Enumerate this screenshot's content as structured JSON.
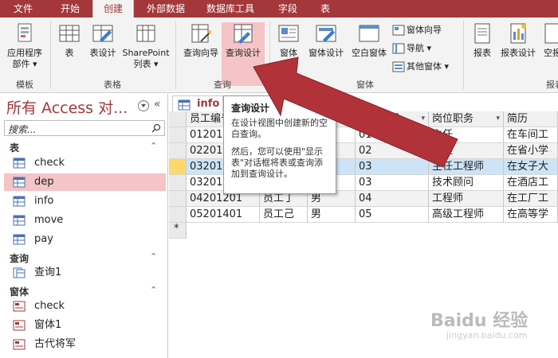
{
  "ribbon_tabs": [
    "文件",
    "开始",
    "创建",
    "外部数据",
    "数据库工具",
    "字段",
    "表"
  ],
  "ribbon": {
    "app_parts": "应用程序部件",
    "app_parts_line1": "应用程序",
    "app_parts_line2": "部件",
    "table": "表",
    "table_design": "表设计",
    "sharepoint_line1": "SharePoint",
    "sharepoint_line2": "列表",
    "query_wizard": "查询向导",
    "query_design": "查询设计",
    "form": "窗体",
    "form_design": "窗体设计",
    "blank_form": "空白窗体",
    "form_wizard": "窗体向导",
    "navigation": "导航",
    "more_forms": "其他窗体",
    "report": "报表",
    "report_design": "报表设计",
    "blank_report": "空报",
    "groups": {
      "templates": "模板",
      "tables": "表格",
      "queries": "查询",
      "forms": "窗体",
      "reports": "报表"
    }
  },
  "nav": {
    "title": "所有 Access 对...",
    "search_placeholder": "搜索...",
    "sections": [
      {
        "label": "表",
        "items": [
          "check",
          "dep",
          "info",
          "move",
          "pay"
        ]
      },
      {
        "label": "查询",
        "items": [
          "查询1"
        ]
      },
      {
        "label": "窗体",
        "items": [
          "check",
          "窗体1",
          "古代将军"
        ]
      }
    ],
    "selected_item": "dep"
  },
  "document": {
    "tab_label": "info",
    "columns": [
      "员工编号",
      "",
      "",
      "部门编号",
      "岗位职务",
      "简历"
    ],
    "rows": [
      [
        "01201501",
        "",
        "",
        "01",
        "主任",
        "在车间工"
      ],
      [
        "02201601",
        "",
        "",
        "02",
        "助理",
        "在省小学"
      ],
      [
        "03201",
        "",
        "",
        "03",
        "主任工程师",
        "在女子大"
      ],
      [
        "03201801",
        "",
        "",
        "03",
        "技术顾问",
        "在酒店工"
      ],
      [
        "04201201",
        "员工丁",
        "男",
        "04",
        "工程师",
        "在工厂工"
      ],
      [
        "05201401",
        "员工己",
        "男",
        "05",
        "高级工程师",
        "在高等学"
      ]
    ],
    "new_row_marker": "*"
  },
  "tooltip": {
    "title": "查询设计",
    "line1": "在设计视图中创建新的空白查询。",
    "line2": "然后，您可以使用\"显示表\"对话框将表或查询添加到查询设计。"
  },
  "colors": {
    "accent": "#a4373a",
    "selection": "#f4c4c6",
    "arrow": "#b2323a"
  },
  "watermark": {
    "logo": "Baidu 经验",
    "url": "jingyan.baidu.com"
  }
}
